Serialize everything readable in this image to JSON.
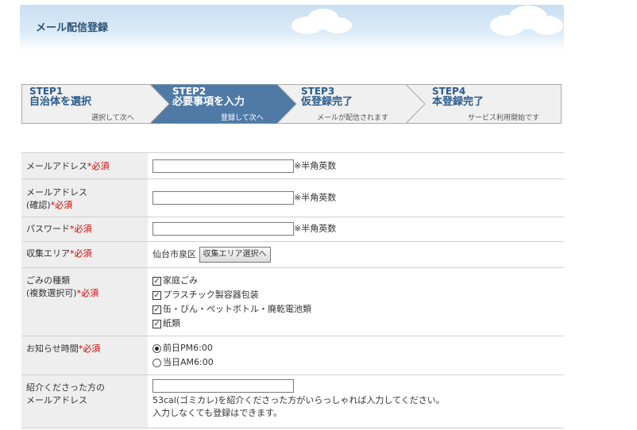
{
  "header": {
    "title": "メール配信登録"
  },
  "steps": [
    {
      "head1": "STEP1",
      "head2": "自治体を選択",
      "sub": "選択して次へ",
      "active": false
    },
    {
      "head1": "STEP2",
      "head2": "必要事項を入力",
      "sub": "登録して次へ",
      "active": true
    },
    {
      "head1": "STEP3",
      "head2": "仮登録完了",
      "sub": "メールが配信されます",
      "active": false
    },
    {
      "head1": "STEP4",
      "head2": "本登録完了",
      "sub": "サービス利用開始です",
      "active": false
    }
  ],
  "colors": {
    "active_step": "#4f7aa6",
    "inactive_step": "#f0f0f0",
    "step_text": "#2a5b8c",
    "required": "#d40000"
  },
  "form": {
    "required_mark": "*必須",
    "email": {
      "label": "メールアドレス",
      "value": "",
      "note": "※半角英数"
    },
    "email_confirm": {
      "label1": "メールアドレス",
      "label2": "(確認)",
      "value": "",
      "note": "※半角英数"
    },
    "password": {
      "label": "パスワード",
      "value": "",
      "note": "※半角英数"
    },
    "area": {
      "label": "収集エリア",
      "value": "仙台市泉区",
      "button": "収集エリア選択へ"
    },
    "garbage": {
      "label1": "ごみの種類",
      "label2": "(複数選択可)",
      "options": [
        {
          "label": "家庭ごみ",
          "checked": true
        },
        {
          "label": "プラスチック製容器包装",
          "checked": true
        },
        {
          "label": "缶・びん・ペットボトル・廃乾電池類",
          "checked": true
        },
        {
          "label": "紙類",
          "checked": true
        }
      ]
    },
    "notify_time": {
      "label": "お知らせ時間",
      "options": [
        {
          "label": "前日PM6:00",
          "selected": true
        },
        {
          "label": "当日AM6:00",
          "selected": false
        }
      ]
    },
    "referrer": {
      "label1": "紹介くださった方の",
      "label2": "メールアドレス",
      "value": "",
      "help1": "53cal(ゴミカレ)を紹介くださった方がいらっしゃれば入力してください。",
      "help2": "入力しなくても登録はできます。"
    }
  }
}
